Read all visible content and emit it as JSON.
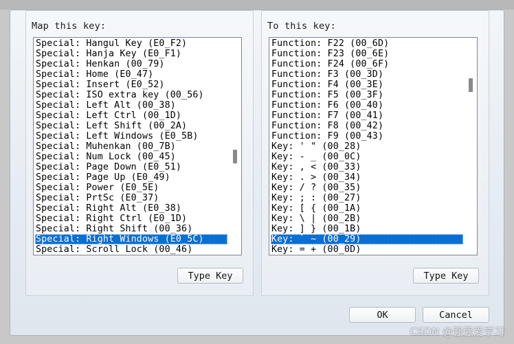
{
  "left_panel": {
    "label": "Map this key:",
    "items": [
      "Special: Hangul Key (E0_F2)",
      "Special: Hanja Key (E0_F1)",
      "Special: Henkan (00_79)",
      "Special: Home (E0_47)",
      "Special: Insert (E0_52)",
      "Special: ISO extra key (00_56)",
      "Special: Left Alt (00_38)",
      "Special: Left Ctrl (00_1D)",
      "Special: Left Shift (00_2A)",
      "Special: Left Windows (E0_5B)",
      "Special: Muhenkan (00_7B)",
      "Special: Num Lock (00_45)",
      "Special: Page Down (E0_51)",
      "Special: Page Up (E0_49)",
      "Special: Power (E0_5E)",
      "Special: PrtSc (E0_37)",
      "Special: Right Alt (E0_38)",
      "Special: Right Ctrl (E0_1D)",
      "Special: Right Shift (00_36)",
      "Special: Right Windows (E0_5C)",
      "Special: Scroll Lock (00_46)"
    ],
    "selected_index": 19,
    "scroll_position": 0.55,
    "type_key_label": "Type Key"
  },
  "right_panel": {
    "label": "To this key:",
    "items": [
      "Function: F22 (00_6D)",
      "Function: F23 (00_6E)",
      "Function: F24 (00_6F)",
      "Function: F3 (00_3D)",
      "Function: F4 (00_3E)",
      "Function: F5 (00_3F)",
      "Function: F6 (00_40)",
      "Function: F7 (00_41)",
      "Function: F8 (00_42)",
      "Function: F9 (00_43)",
      "Key: ' \" (00_28)",
      "Key: - _ (00_0C)",
      "Key: , < (00_33)",
      "Key: . > (00_34)",
      "Key: / ? (00_35)",
      "Key: ; : (00_27)",
      "Key: [ { (00_1A)",
      "Key: \\ | (00_2B)",
      "Key: ] } (00_1B)",
      "Key: ` ~ (00_29)",
      "Key: = + (00_0D)"
    ],
    "selected_index": 19,
    "scroll_position": 0.2,
    "type_key_label": "Type Key"
  },
  "footer": {
    "ok_label": "OK",
    "cancel_label": "Cancel"
  },
  "watermark": "CSDN @强强爱学习",
  "colors": {
    "selection": "#0a6fd1",
    "dialog_bg": "#e6ecf3"
  }
}
